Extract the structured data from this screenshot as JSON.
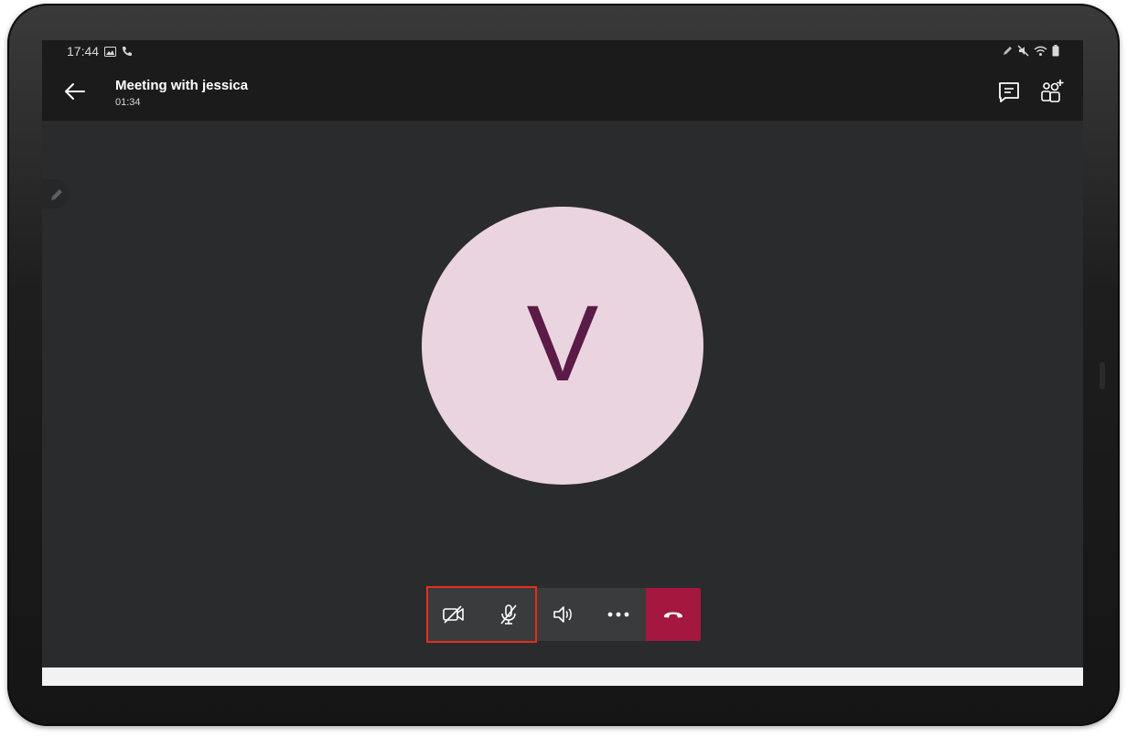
{
  "status_bar": {
    "time": "17:44",
    "left_icons": [
      "image-icon",
      "phone-icon"
    ],
    "right_icons": [
      "pen-icon",
      "mute-icon",
      "wifi-icon",
      "battery-icon"
    ]
  },
  "header": {
    "title": "Meeting with jessica",
    "duration": "01:34",
    "icons": [
      "back-arrow-icon",
      "chat-icon",
      "add-people-icon"
    ]
  },
  "participant": {
    "initial": "V",
    "avatar_bg": "#ead4df",
    "initial_color": "#5a1b46"
  },
  "controls": [
    {
      "name": "camera-off-button",
      "icon": "camera-off-icon"
    },
    {
      "name": "mic-off-button",
      "icon": "mic-off-icon"
    },
    {
      "name": "speaker-button",
      "icon": "speaker-icon"
    },
    {
      "name": "more-options-button",
      "icon": "more-icon"
    },
    {
      "name": "end-call-button",
      "icon": "hang-up-icon",
      "color": "#a4173f"
    }
  ],
  "colors": {
    "stage_bg": "#2a2b2d",
    "header_bg": "#1b1b1c",
    "highlight": "#e53019"
  }
}
